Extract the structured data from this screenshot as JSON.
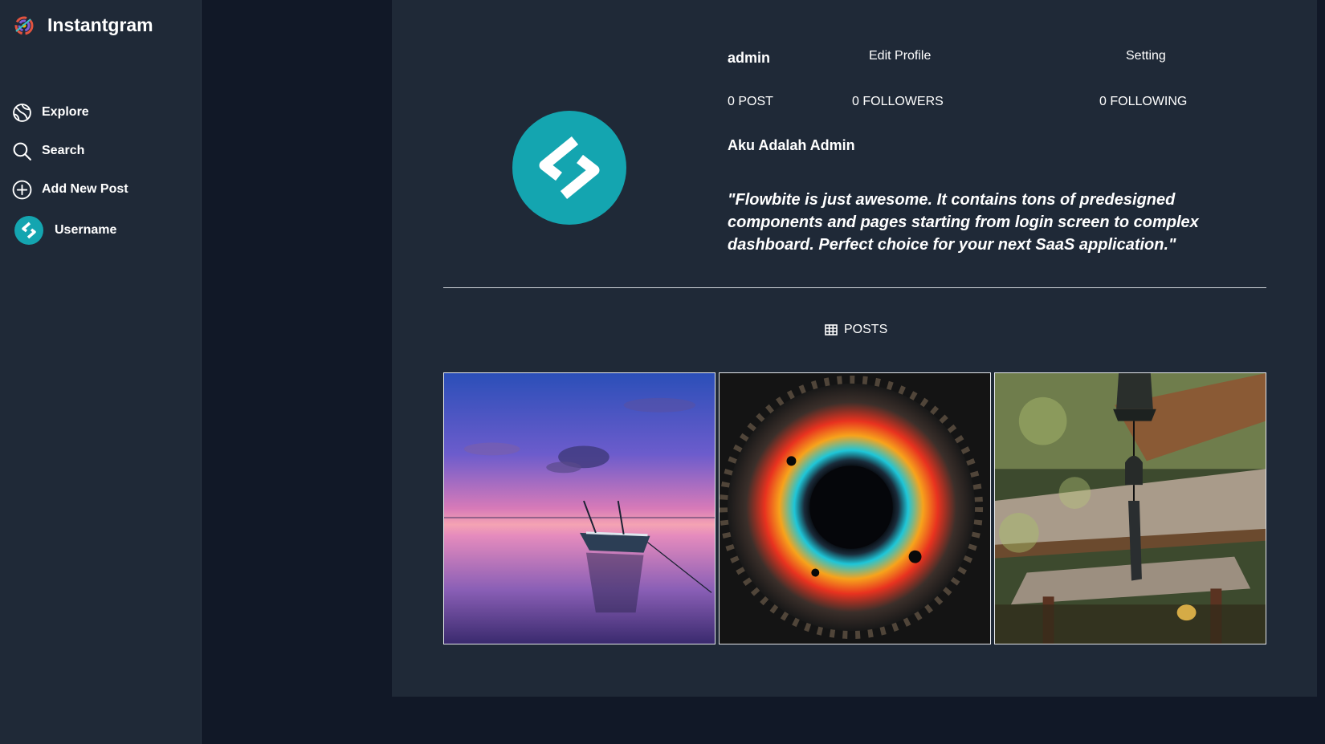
{
  "app": {
    "name": "Instantgram"
  },
  "sidebar": {
    "items": [
      {
        "label": "Explore",
        "icon": "explore-icon"
      },
      {
        "label": "Search",
        "icon": "search-icon"
      },
      {
        "label": "Add New Post",
        "icon": "plus-circle-icon"
      }
    ],
    "user": {
      "label": "Username",
      "icon": "avatar"
    }
  },
  "profile": {
    "username": "admin",
    "edit_label": "Edit Profile",
    "setting_label": "Setting",
    "stats": {
      "posts": "0 POST",
      "followers": "0 FOLLOWERS",
      "following": "0 FOLLOWING"
    },
    "display_name": "Aku Adalah Admin",
    "bio": "\"Flowbite is just awesome. It contains tons of predesigned components and pages starting from login screen to complex dashboard. Perfect choice for your next SaaS application.\""
  },
  "tabs": {
    "posts_label": "POSTS",
    "posts_icon": "grid-icon"
  },
  "posts": [
    {
      "image": "sunset-boat-image"
    },
    {
      "image": "colorful-vortex-image"
    },
    {
      "image": "temple-bell-image"
    }
  ],
  "colors": {
    "page_bg": "#111827",
    "panel_bg": "#1f2937",
    "avatar_teal": "#14a5b0",
    "text": "#ffffff"
  }
}
